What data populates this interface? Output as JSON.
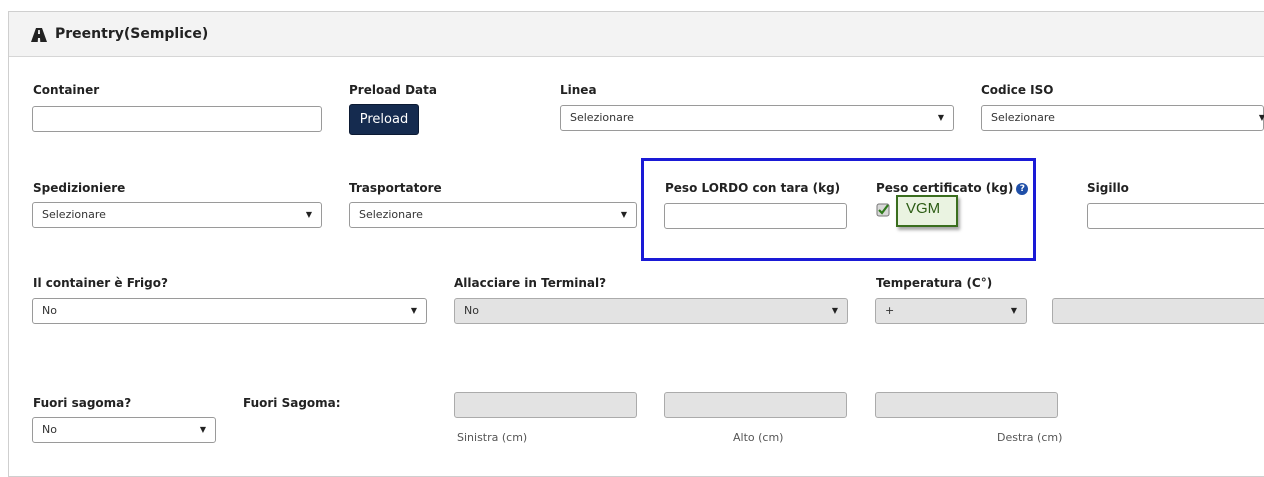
{
  "panel": {
    "title": "Preentry(Semplice)"
  },
  "row1": {
    "container_label": "Container",
    "preload_label": "Preload Data",
    "preload_button": "Preload",
    "linea_label": "Linea",
    "linea_value": "Selezionare",
    "iso_label": "Codice ISO",
    "iso_value": "Selezionare"
  },
  "row2": {
    "spedizioniere_label": "Spedizioniere",
    "spedizioniere_value": "Selezionare",
    "trasportatore_label": "Trasportatore",
    "trasportatore_value": "Selezionare",
    "peso_lordo_label": "Peso LORDO con tara (kg)",
    "peso_cert_label": "Peso certificato (kg)",
    "vgm_label": "VGM",
    "sigillo_label": "Sigillo"
  },
  "row3": {
    "frigo_label": "Il container è Frigo?",
    "frigo_value": "No",
    "allacciare_label": "Allacciare in Terminal?",
    "allacciare_value": "No",
    "temperatura_label": "Temperatura (C°)",
    "temperatura_value": "+"
  },
  "row4": {
    "fuori_label": "Fuori sagoma?",
    "fuori_value": "No",
    "fuori_sagoma_label": "Fuori Sagoma:",
    "sinistra_label": "Sinistra (cm)",
    "alto_label": "Alto (cm)",
    "destra_label": "Destra (cm)"
  },
  "colors": {
    "highlight": "#1a1ad6",
    "button": "#152b4f",
    "help_icon": "#1f4fa8",
    "vgm_border": "#3a6e1e"
  },
  "icons": [
    "road-icon",
    "chevron-down-icon",
    "question-circle-icon",
    "checkbox-checked-icon"
  ]
}
